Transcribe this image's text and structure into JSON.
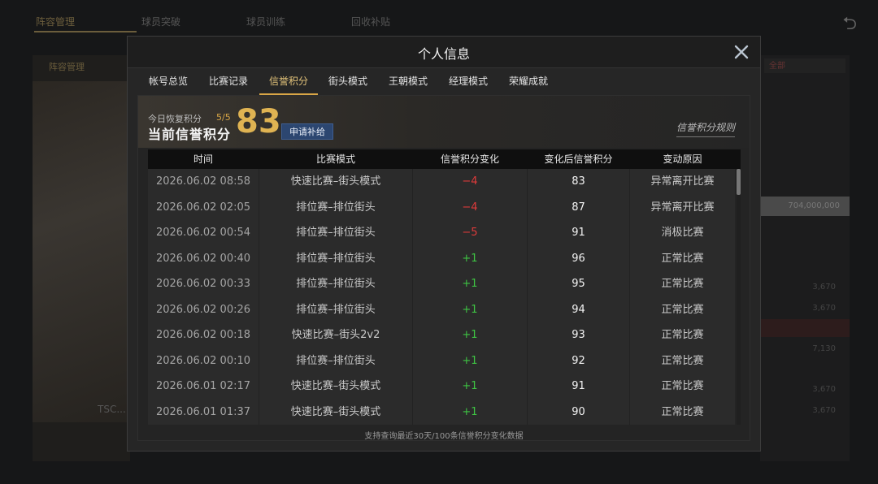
{
  "background": {
    "tabs": [
      "阵容管理",
      "球员突破",
      "球员训练",
      "回收补贴"
    ],
    "sub_tab": "阵容管理",
    "player_text": "TSC...",
    "right_select": "全部",
    "right_field": "704,000,000",
    "right_values": [
      "3,670",
      "3,670",
      "7,130",
      "3,670",
      "3,670"
    ]
  },
  "modal": {
    "title": "个人信息",
    "tabs": [
      {
        "label": "帐号总览"
      },
      {
        "label": "比赛记录"
      },
      {
        "label": "信誉积分"
      },
      {
        "label": "街头模式"
      },
      {
        "label": "王朝模式"
      },
      {
        "label": "经理模式"
      },
      {
        "label": "荣耀成就"
      }
    ],
    "active_tab": "信誉积分",
    "summary": {
      "recover_label": "今日恢复积分",
      "recover_count": "5/5",
      "score_label": "当前信誉积分",
      "score_value": "83",
      "apply_button": "申请补给",
      "rules_link": "信誉积分规则"
    },
    "table": {
      "headers": [
        "时间",
        "比赛模式",
        "信誉积分变化",
        "变化后信誉积分",
        "变动原因"
      ],
      "rows": [
        {
          "time": "2026.06.02  08:58",
          "mode": "快速比赛–街头模式",
          "delta": "−4",
          "after": "83",
          "reason": "异常离开比赛"
        },
        {
          "time": "2026.06.02  02:05",
          "mode": "排位赛–排位街头",
          "delta": "−4",
          "after": "87",
          "reason": "异常离开比赛"
        },
        {
          "time": "2026.06.02  00:54",
          "mode": "排位赛–排位街头",
          "delta": "−5",
          "after": "91",
          "reason": "消极比赛"
        },
        {
          "time": "2026.06.02  00:40",
          "mode": "排位赛–排位街头",
          "delta": "+1",
          "after": "96",
          "reason": "正常比赛"
        },
        {
          "time": "2026.06.02  00:33",
          "mode": "排位赛–排位街头",
          "delta": "+1",
          "after": "95",
          "reason": "正常比赛"
        },
        {
          "time": "2026.06.02  00:26",
          "mode": "排位赛–排位街头",
          "delta": "+1",
          "after": "94",
          "reason": "正常比赛"
        },
        {
          "time": "2026.06.02  00:18",
          "mode": "快速比赛–街头2v2",
          "delta": "+1",
          "after": "93",
          "reason": "正常比赛"
        },
        {
          "time": "2026.06.02  00:10",
          "mode": "排位赛–排位街头",
          "delta": "+1",
          "after": "92",
          "reason": "正常比赛"
        },
        {
          "time": "2026.06.01  02:17",
          "mode": "快速比赛–街头模式",
          "delta": "+1",
          "after": "91",
          "reason": "正常比赛"
        },
        {
          "time": "2026.06.01  01:37",
          "mode": "快速比赛–街头模式",
          "delta": "+1",
          "after": "90",
          "reason": "正常比赛"
        }
      ]
    },
    "footer_note": "支持查询最近30天/100条信誉积分变化数据"
  },
  "colors": {
    "accent_gold": "#d9a646",
    "negative": "#e03b3b",
    "positive": "#3ec443",
    "button_blue": "#2c4670"
  },
  "icons": {
    "close": "close-icon",
    "back": "back-arrow-icon"
  }
}
